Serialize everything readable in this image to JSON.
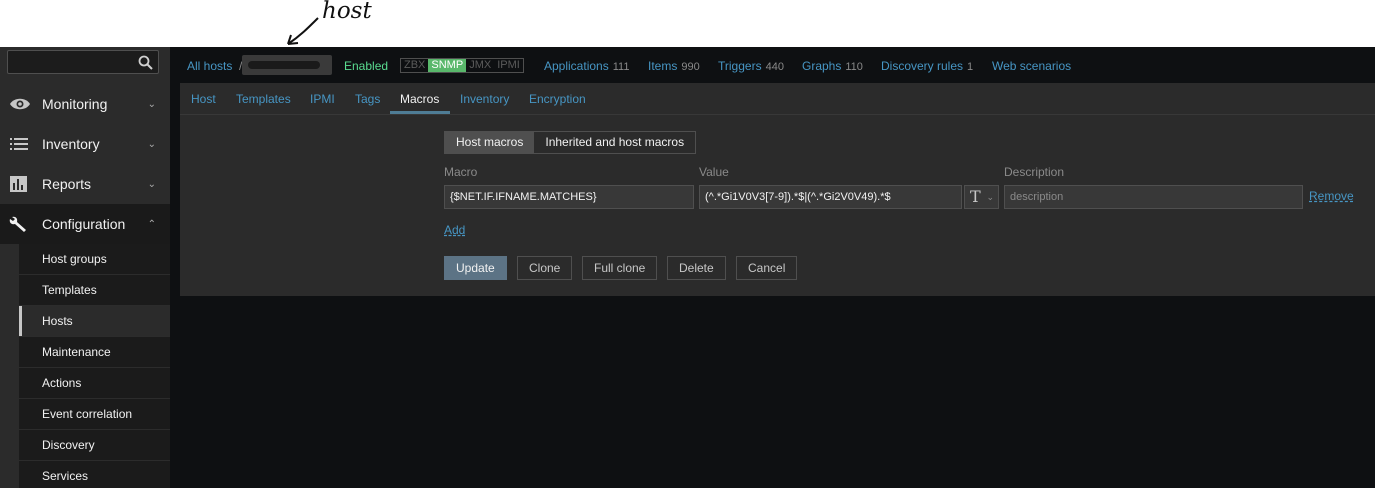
{
  "annotation": {
    "text": "host"
  },
  "sidebar": {
    "menu": [
      {
        "label": "Monitoring",
        "icon": "eye-icon"
      },
      {
        "label": "Inventory",
        "icon": "list-icon"
      },
      {
        "label": "Reports",
        "icon": "bar-chart-icon"
      },
      {
        "label": "Configuration",
        "icon": "wrench-icon"
      }
    ],
    "submenu": [
      {
        "label": "Host groups"
      },
      {
        "label": "Templates"
      },
      {
        "label": "Hosts",
        "active": true
      },
      {
        "label": "Maintenance"
      },
      {
        "label": "Actions"
      },
      {
        "label": "Event correlation"
      },
      {
        "label": "Discovery"
      },
      {
        "label": "Services"
      }
    ]
  },
  "hostnav": {
    "all_hosts": "All hosts",
    "separator": "/",
    "status": "Enabled",
    "badges": [
      "ZBX",
      "SNMP",
      "JMX",
      "IPMI"
    ],
    "active_badge": "SNMP",
    "links": [
      {
        "label": "Applications",
        "count": "111"
      },
      {
        "label": "Items",
        "count": "990"
      },
      {
        "label": "Triggers",
        "count": "440"
      },
      {
        "label": "Graphs",
        "count": "110"
      },
      {
        "label": "Discovery rules",
        "count": "1"
      },
      {
        "label": "Web scenarios",
        "count": ""
      }
    ]
  },
  "tabs": [
    "Host",
    "Templates",
    "IPMI",
    "Tags",
    "Macros",
    "Inventory",
    "Encryption"
  ],
  "active_tab": "Macros",
  "macros": {
    "radio": [
      "Host macros",
      "Inherited and host macros"
    ],
    "columns": {
      "macro": "Macro",
      "value": "Value",
      "description": "Description"
    },
    "row": {
      "macro": "{$NET.IF.IFNAME.MATCHES}",
      "value": "(^.*Gi1V0V3[7-9]).*$|(^.*Gi2V0V49).*$",
      "type_symbol": "T",
      "description_placeholder": "description",
      "remove": "Remove"
    },
    "add": "Add"
  },
  "buttons": {
    "update": "Update",
    "clone": "Clone",
    "full_clone": "Full clone",
    "delete": "Delete",
    "cancel": "Cancel"
  },
  "colors": {
    "link": "#4796c4",
    "enabled": "#59db8f",
    "snmp_badge": "#59b86b",
    "primary_button": "#5c7385"
  }
}
